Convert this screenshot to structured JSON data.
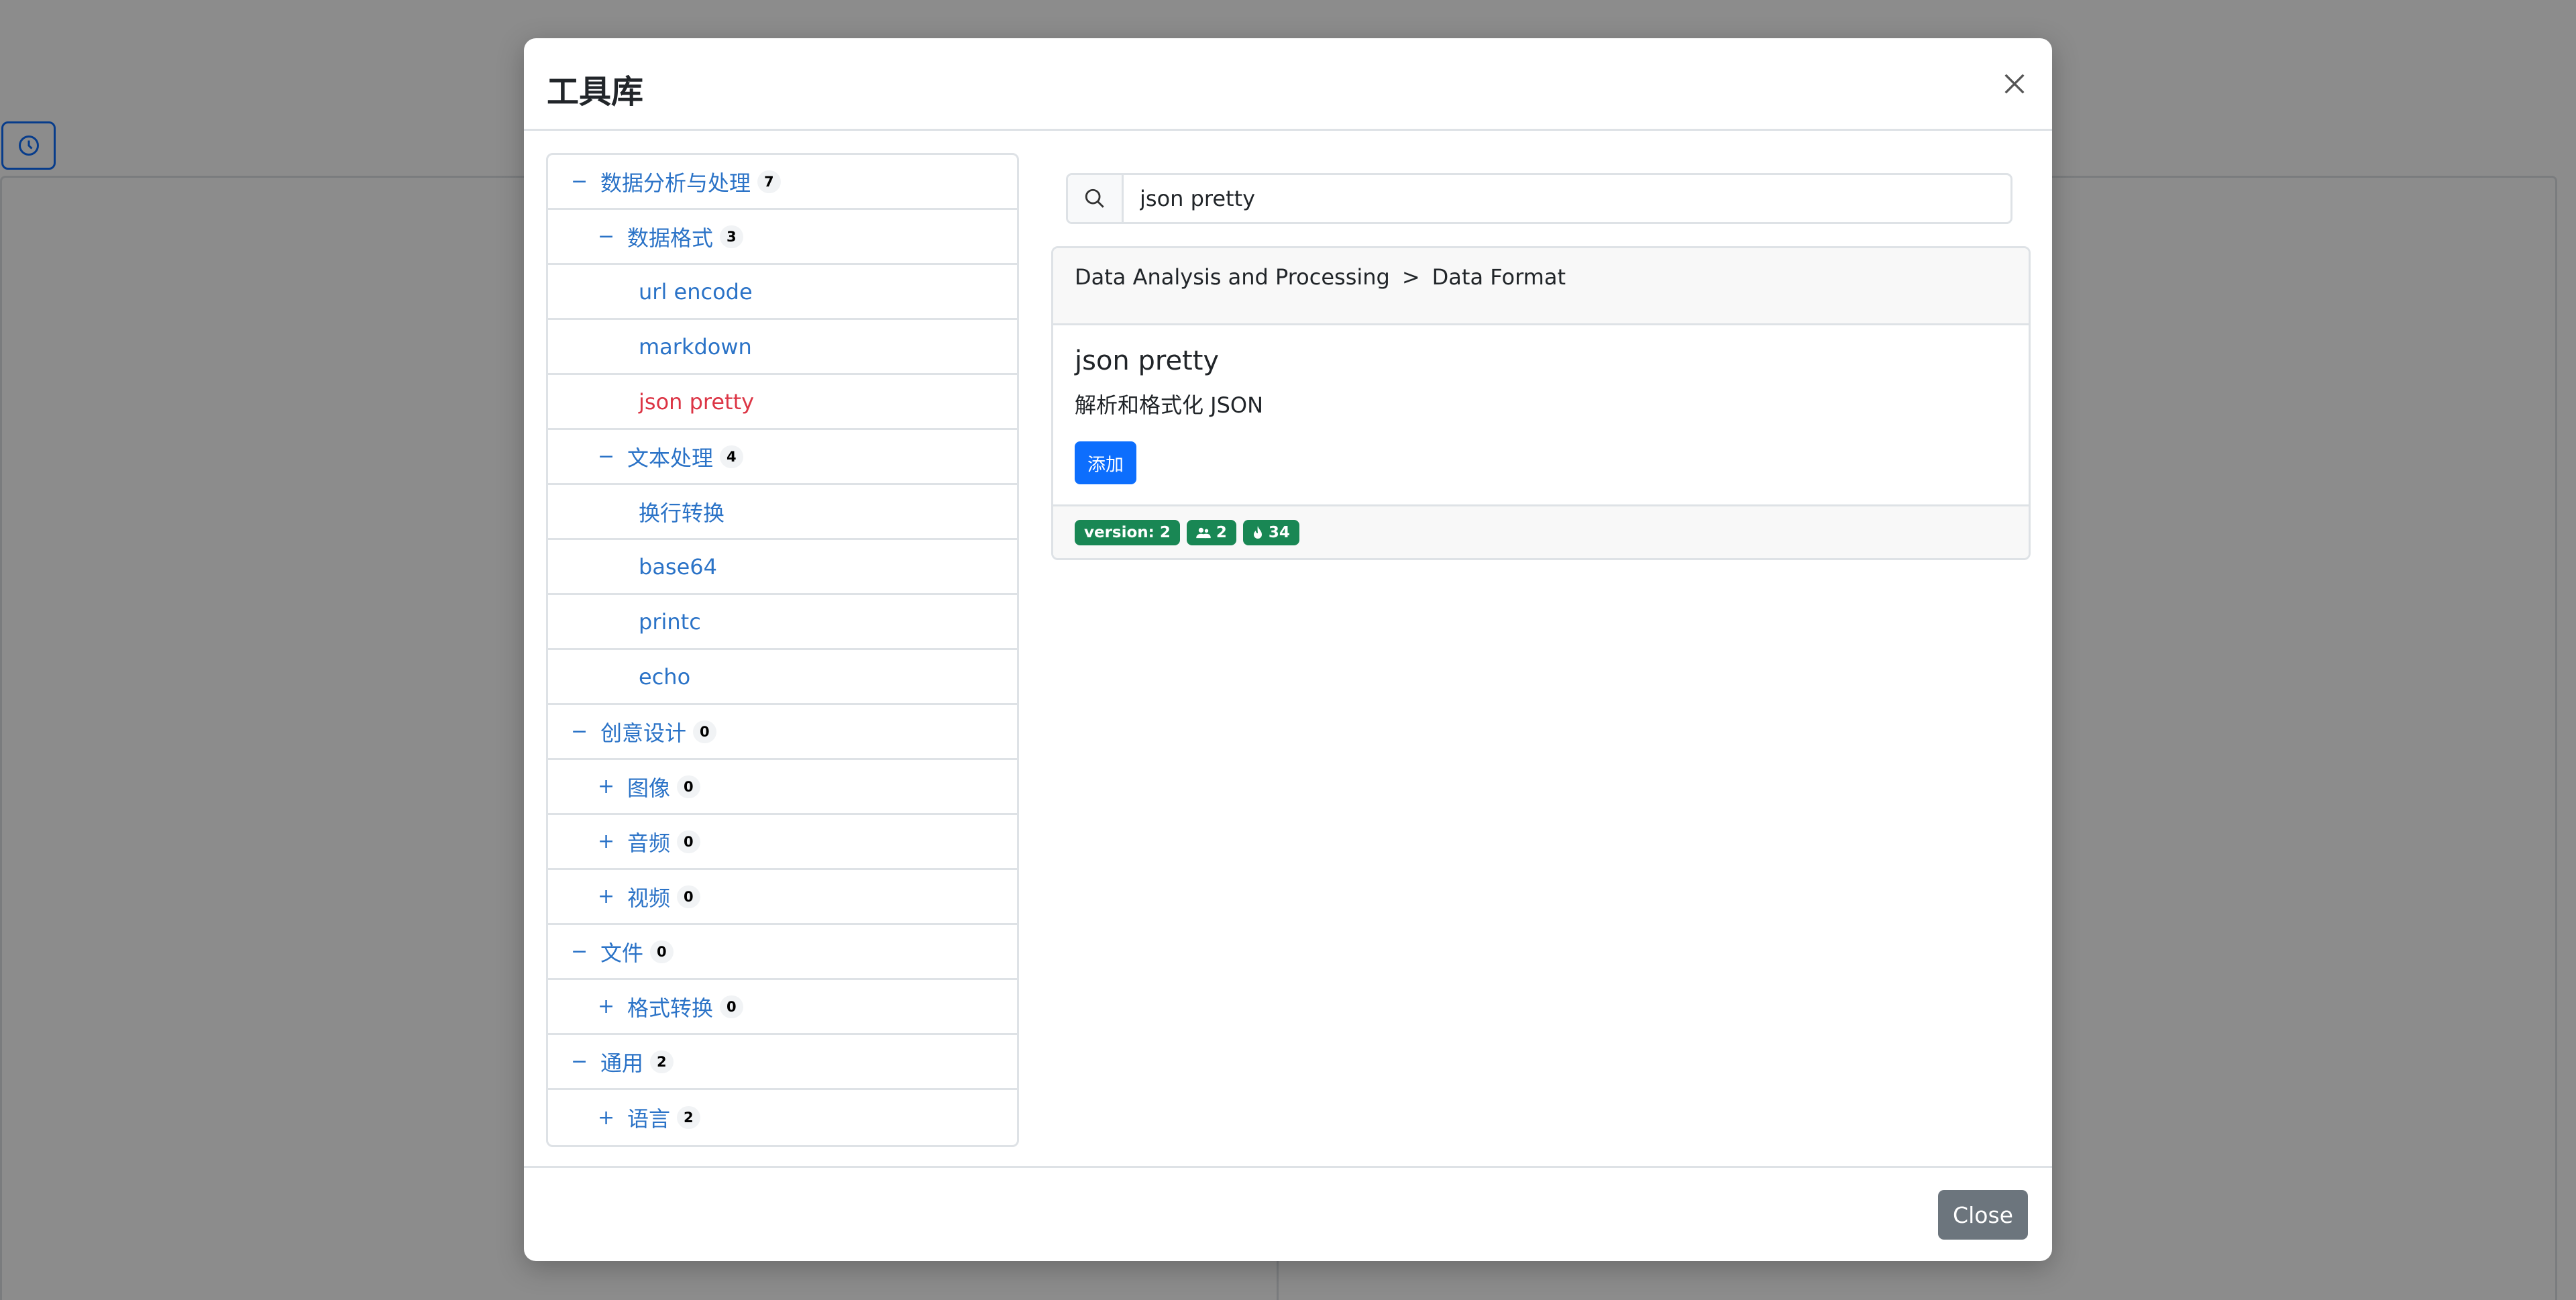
{
  "modal": {
    "title": "工具库",
    "close_label": "Close"
  },
  "tree": [
    {
      "level": 0,
      "toggle": "−",
      "label": "数据分析与处理",
      "count": "7"
    },
    {
      "level": 1,
      "toggle": "−",
      "label": "数据格式",
      "count": "3"
    },
    {
      "level": 2,
      "label": "url encode"
    },
    {
      "level": 2,
      "label": "markdown"
    },
    {
      "level": 2,
      "label": "json pretty",
      "active": true
    },
    {
      "level": 1,
      "toggle": "−",
      "label": "文本处理",
      "count": "4"
    },
    {
      "level": 2,
      "label": "换行转换"
    },
    {
      "level": 2,
      "label": "base64"
    },
    {
      "level": 2,
      "label": "printc"
    },
    {
      "level": 2,
      "label": "echo"
    },
    {
      "level": 0,
      "toggle": "−",
      "label": "创意设计",
      "count": "0"
    },
    {
      "level": 1,
      "toggle": "+",
      "label": "图像",
      "count": "0"
    },
    {
      "level": 1,
      "toggle": "+",
      "label": "音频",
      "count": "0"
    },
    {
      "level": 1,
      "toggle": "+",
      "label": "视频",
      "count": "0"
    },
    {
      "level": 0,
      "toggle": "−",
      "label": "文件",
      "count": "0"
    },
    {
      "level": 1,
      "toggle": "+",
      "label": "格式转换",
      "count": "0"
    },
    {
      "level": 0,
      "toggle": "−",
      "label": "通用",
      "count": "2"
    },
    {
      "level": 1,
      "toggle": "+",
      "label": "语言",
      "count": "2"
    }
  ],
  "search": {
    "value": "json pretty"
  },
  "card": {
    "breadcrumb": [
      "Data Analysis and Processing",
      "Data Format"
    ],
    "breadcrumb_separator": ">",
    "title": "json pretty",
    "description": "解析和格式化 JSON",
    "add_label": "添加",
    "badges": {
      "version": "version: 2",
      "users": "2",
      "hot": "34"
    }
  },
  "colors": {
    "link": "#2b73c7",
    "active": "#dc3545",
    "primary": "#0d6efd",
    "success": "#198754",
    "secondary": "#6c757d"
  },
  "icons": {
    "history": "clock-icon",
    "close": "close-icon",
    "search": "search-icon",
    "users": "users-icon",
    "hot": "fire-icon"
  }
}
